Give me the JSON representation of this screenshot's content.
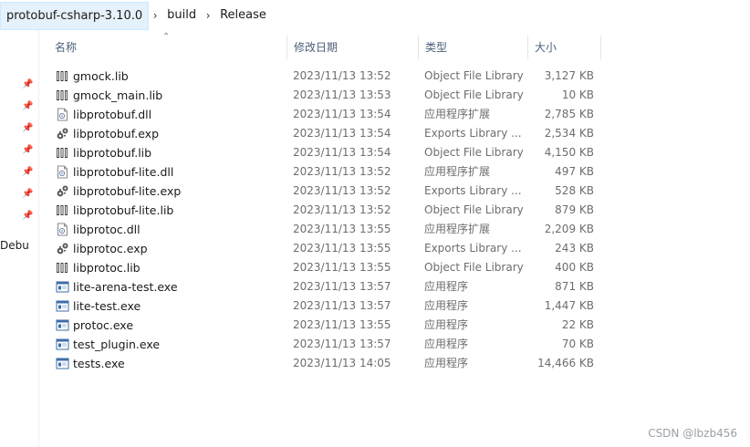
{
  "breadcrumb": {
    "items": [
      "protobuf-csharp-3.10.0",
      "build",
      "Release"
    ],
    "separator": "›"
  },
  "nav": {
    "partial_label": "Debu"
  },
  "columns": {
    "name": "名称",
    "date": "修改日期",
    "type": "类型",
    "size": "大小"
  },
  "files": [
    {
      "name": "gmock.lib",
      "date": "2023/11/13 13:52",
      "type": "Object File Library",
      "size": "3,127 KB",
      "icon": "lib-icon"
    },
    {
      "name": "gmock_main.lib",
      "date": "2023/11/13 13:53",
      "type": "Object File Library",
      "size": "10 KB",
      "icon": "lib-icon"
    },
    {
      "name": "libprotobuf.dll",
      "date": "2023/11/13 13:54",
      "type": "应用程序扩展",
      "size": "2,785 KB",
      "icon": "dll-icon"
    },
    {
      "name": "libprotobuf.exp",
      "date": "2023/11/13 13:54",
      "type": "Exports Library ...",
      "size": "2,534 KB",
      "icon": "exp-icon"
    },
    {
      "name": "libprotobuf.lib",
      "date": "2023/11/13 13:54",
      "type": "Object File Library",
      "size": "4,150 KB",
      "icon": "lib-icon"
    },
    {
      "name": "libprotobuf-lite.dll",
      "date": "2023/11/13 13:52",
      "type": "应用程序扩展",
      "size": "497 KB",
      "icon": "dll-icon"
    },
    {
      "name": "libprotobuf-lite.exp",
      "date": "2023/11/13 13:52",
      "type": "Exports Library ...",
      "size": "528 KB",
      "icon": "exp-icon"
    },
    {
      "name": "libprotobuf-lite.lib",
      "date": "2023/11/13 13:52",
      "type": "Object File Library",
      "size": "879 KB",
      "icon": "lib-icon"
    },
    {
      "name": "libprotoc.dll",
      "date": "2023/11/13 13:55",
      "type": "应用程序扩展",
      "size": "2,209 KB",
      "icon": "dll-icon"
    },
    {
      "name": "libprotoc.exp",
      "date": "2023/11/13 13:55",
      "type": "Exports Library ...",
      "size": "243 KB",
      "icon": "exp-icon"
    },
    {
      "name": "libprotoc.lib",
      "date": "2023/11/13 13:55",
      "type": "Object File Library",
      "size": "400 KB",
      "icon": "lib-icon"
    },
    {
      "name": "lite-arena-test.exe",
      "date": "2023/11/13 13:57",
      "type": "应用程序",
      "size": "871 KB",
      "icon": "exe-icon"
    },
    {
      "name": "lite-test.exe",
      "date": "2023/11/13 13:57",
      "type": "应用程序",
      "size": "1,447 KB",
      "icon": "exe-icon"
    },
    {
      "name": "protoc.exe",
      "date": "2023/11/13 13:55",
      "type": "应用程序",
      "size": "22 KB",
      "icon": "exe-icon"
    },
    {
      "name": "test_plugin.exe",
      "date": "2023/11/13 13:57",
      "type": "应用程序",
      "size": "70 KB",
      "icon": "exe-icon"
    },
    {
      "name": "tests.exe",
      "date": "2023/11/13 14:05",
      "type": "应用程序",
      "size": "14,466 KB",
      "icon": "exe-icon"
    }
  ],
  "watermark": "CSDN @lbzb456",
  "colors": {
    "breadcrumb_highlight": "#e5f1fb",
    "header_text": "#4c607a",
    "meta_text": "#6d6d6d"
  }
}
